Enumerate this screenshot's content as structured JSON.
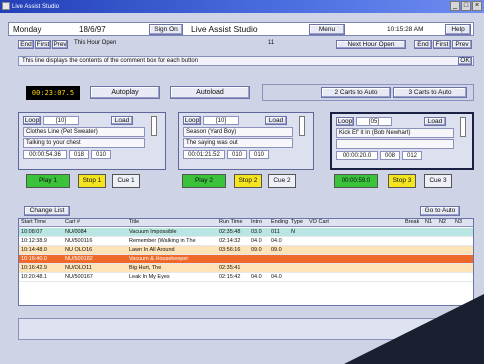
{
  "window": {
    "title": "Live Assist Studio"
  },
  "header": {
    "day": "Monday",
    "date": "18/6/97",
    "sign_on": "Sign On",
    "app_name": "Live Assist Studio",
    "menu": "Menu",
    "time": "10:15:28 AM",
    "help": "Help"
  },
  "subheader": {
    "this_hour_open": "This Hour Open",
    "hour_number": "11",
    "next_hour_open": "Next Hour Open",
    "end": "End",
    "first": "First",
    "prev": "Prev"
  },
  "info": {
    "text": "This line displays the contents of the comment box for each button",
    "ok": "OK"
  },
  "counter": {
    "value": "00:23:07.5"
  },
  "modes": {
    "autoplay": "Autoplay",
    "autoload": "Autoload",
    "carts_to_auto_2": "2 Carts to Auto",
    "carts_to_auto_3": "3 Carts to Auto"
  },
  "players": [
    {
      "loop": "Loop",
      "cart": "[10]",
      "load": "Load",
      "line1": "Clothes Line (Pet Sweater)",
      "line2": "Talking to your chest",
      "time": "00:00:54.36",
      "v1": "018",
      "v2": "010",
      "play": "Play 1",
      "stop": "Stop 1",
      "cue": "Cue 1"
    },
    {
      "loop": "Loop",
      "cart": "[10]",
      "load": "Load",
      "line1": "Season (Yard Boy)",
      "line2": "The saying was out",
      "time": "00:01:21.52",
      "v1": "010",
      "v2": "010",
      "play": "Play 2",
      "stop": "Stop 2",
      "cue": "Cue 2"
    },
    {
      "loop": "Loop",
      "cart": "[05]",
      "load": "Load",
      "line1": "Kick Ef' it In (Bob Newhart)",
      "line2": "",
      "time": "00:00:20.0",
      "v1": "008",
      "v2": "012",
      "play": "00:00:59.0",
      "stop": "Stop 3",
      "cue": "Cue 3"
    }
  ],
  "list": {
    "change_list": "Change List",
    "go_to_auto": "Go to Auto",
    "columns": [
      "Start Time",
      "Cart #",
      "Title",
      "Run Time",
      "Intro",
      "Ending",
      "Type",
      "VO Cart",
      "Break",
      "N1",
      "N2",
      "N3"
    ],
    "rows": [
      [
        "10:08:07",
        "NU/0084",
        "Vacuum Impossible",
        "02:35:48",
        "03.0",
        "011",
        "N",
        "",
        "",
        "",
        "",
        ""
      ],
      [
        "10:12:38.9",
        "NU/500116",
        "Remember (Walking in The",
        "02:14:32",
        "04.0",
        "04.0",
        "",
        "",
        "",
        "",
        "",
        ""
      ],
      [
        "10:14:48.0",
        "NU OLO16",
        "Lawn In All Around",
        "03:56:16",
        "09.0",
        "09.0",
        "",
        "",
        "",
        "",
        "",
        ""
      ],
      [
        "10:16:40.0",
        "NU/500182",
        "Vacuum & Housekeeper",
        "",
        "",
        "",
        "",
        "",
        "",
        "",
        "",
        ""
      ],
      [
        "10:16:42.9",
        "NU/OLO11",
        "Big Hurt, The",
        "02:35:41",
        "",
        "",
        "",
        "",
        "",
        "",
        "",
        ""
      ],
      [
        "10:20:48.1",
        "NU/500167",
        "Leak In My Eyes",
        "02:15:42",
        "04.0",
        "04.0",
        "",
        "",
        "",
        "",
        "",
        ""
      ]
    ]
  },
  "colors": {
    "row_teal": "#b9e6e3",
    "row_orange": "#ef6a2a",
    "row_highlight": "#ffe3b8",
    "play_green": "#39c23a",
    "stop_yellow": "#f5e51e"
  }
}
